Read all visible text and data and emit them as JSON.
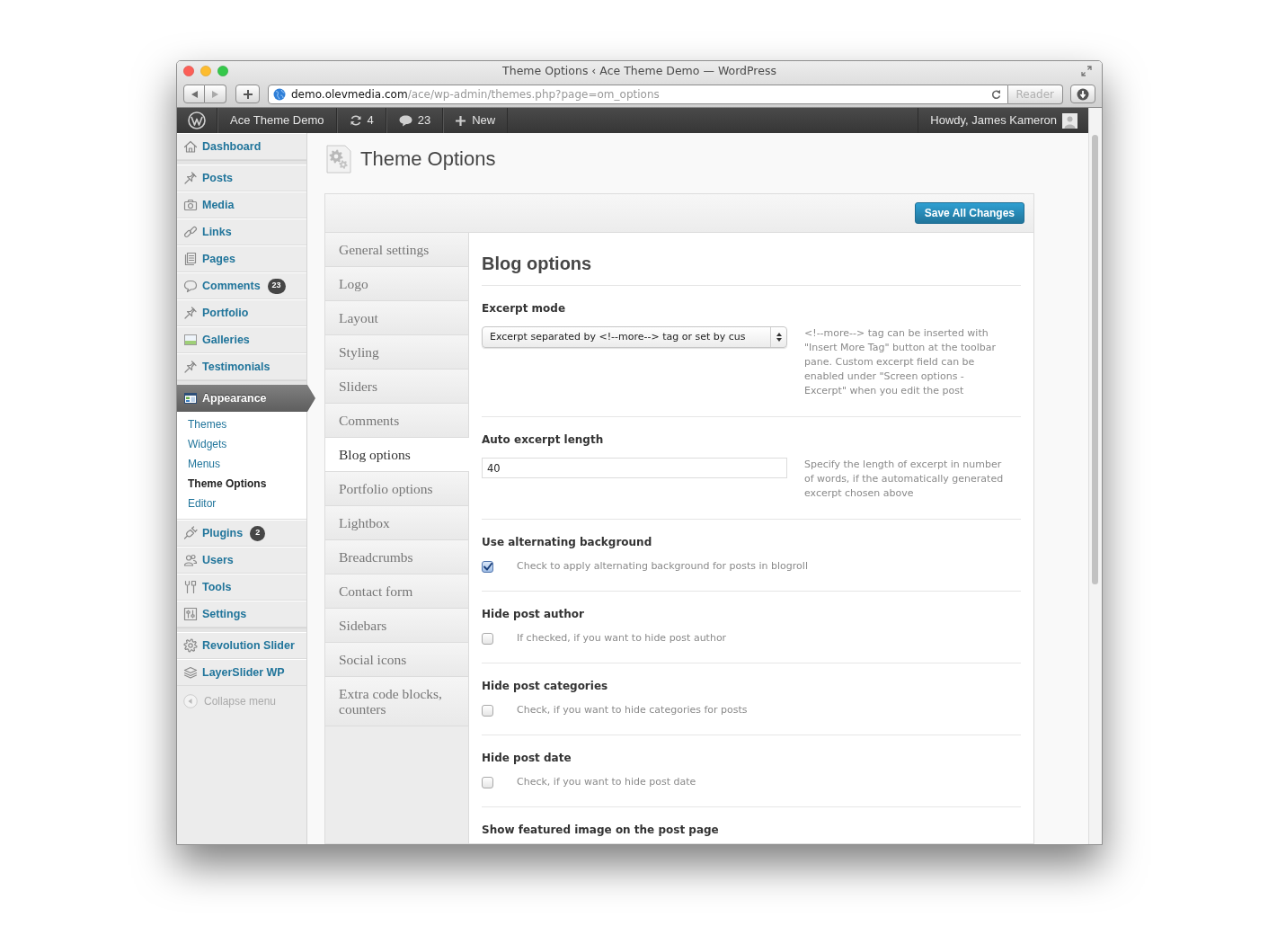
{
  "window": {
    "title": "Theme Options ‹ Ace Theme Demo — WordPress"
  },
  "toolbar": {
    "url_host": "demo.olevmedia.com",
    "url_path": "/ace/wp-admin/themes.php?page=om_options",
    "reader_button": {
      "label": "Reader",
      "disabled": true
    }
  },
  "admin_bar": {
    "site_name": "Ace Theme Demo",
    "updates": "4",
    "comments": "23",
    "new": "New",
    "greeting": "Howdy, James Kameron"
  },
  "sidebar": {
    "groups": [
      {
        "items": [
          {
            "label": "Dashboard",
            "selected": false
          }
        ]
      },
      {
        "items": [
          {
            "label": "Posts",
            "selected": false
          },
          {
            "label": "Media",
            "selected": false
          },
          {
            "label": "Links",
            "selected": false
          },
          {
            "label": "Pages",
            "selected": false
          },
          {
            "label": "Comments",
            "selected": false,
            "badge": "23"
          },
          {
            "label": "Portfolio",
            "selected": false
          },
          {
            "label": "Galleries",
            "selected": false
          },
          {
            "label": "Testimonials",
            "selected": false
          }
        ]
      },
      {
        "items": [
          {
            "label": "Appearance",
            "selected": true,
            "children": [
              {
                "label": "Themes",
                "selected": false
              },
              {
                "label": "Widgets",
                "selected": false
              },
              {
                "label": "Menus",
                "selected": false
              },
              {
                "label": "Theme Options",
                "selected": true
              },
              {
                "label": "Editor",
                "selected": false
              }
            ]
          },
          {
            "label": "Plugins",
            "selected": false,
            "badge": "2"
          },
          {
            "label": "Users",
            "selected": false
          },
          {
            "label": "Tools",
            "selected": false
          },
          {
            "label": "Settings",
            "selected": false
          }
        ]
      },
      {
        "items": [
          {
            "label": "Revolution Slider",
            "selected": false
          },
          {
            "label": "LayerSlider WP",
            "selected": false
          }
        ]
      }
    ],
    "collapse_label": "Collapse menu"
  },
  "page": {
    "title": "Theme Options"
  },
  "options_panel": {
    "save_button": "Save All Changes",
    "tabs": [
      {
        "label": "General settings",
        "selected": false
      },
      {
        "label": "Logo",
        "selected": false
      },
      {
        "label": "Layout",
        "selected": false
      },
      {
        "label": "Styling",
        "selected": false
      },
      {
        "label": "Sliders",
        "selected": false
      },
      {
        "label": "Comments",
        "selected": false
      },
      {
        "label": "Blog options",
        "selected": true
      },
      {
        "label": "Portfolio options",
        "selected": false
      },
      {
        "label": "Lightbox",
        "selected": false
      },
      {
        "label": "Breadcrumbs",
        "selected": false
      },
      {
        "label": "Contact form",
        "selected": false
      },
      {
        "label": "Sidebars",
        "selected": false
      },
      {
        "label": "Social icons",
        "selected": false
      },
      {
        "label": "Extra code blocks, counters",
        "selected": false
      }
    ],
    "section": {
      "title": "Blog options",
      "options": [
        {
          "kind": "select",
          "label": "Excerpt mode",
          "value": "Excerpt separated by <!--more--> tag or set by cus",
          "description": "<!--more--> tag can be inserted with \"Insert More Tag\" button at the toolbar pane. Custom excerpt field can be enabled under \"Screen options - Excerpt\" when you edit the post"
        },
        {
          "kind": "text",
          "label": "Auto excerpt length",
          "value": "40",
          "description": "Specify the length of excerpt in number of words, if the automatically generated excerpt chosen above"
        },
        {
          "kind": "checkbox",
          "label": "Use alternating background",
          "checked": true,
          "description": "Check to apply alternating background for posts in blogroll"
        },
        {
          "kind": "checkbox",
          "label": "Hide post author",
          "checked": false,
          "description": "If checked, if you want to hide post author"
        },
        {
          "kind": "checkbox",
          "label": "Hide post categories",
          "checked": false,
          "description": "Check, if you want to hide categories for posts"
        },
        {
          "kind": "checkbox",
          "label": "Hide post date",
          "checked": false,
          "description": "Check, if you want to hide post date"
        },
        {
          "kind": "heading",
          "label": "Show featured image on the post page"
        }
      ]
    }
  }
}
